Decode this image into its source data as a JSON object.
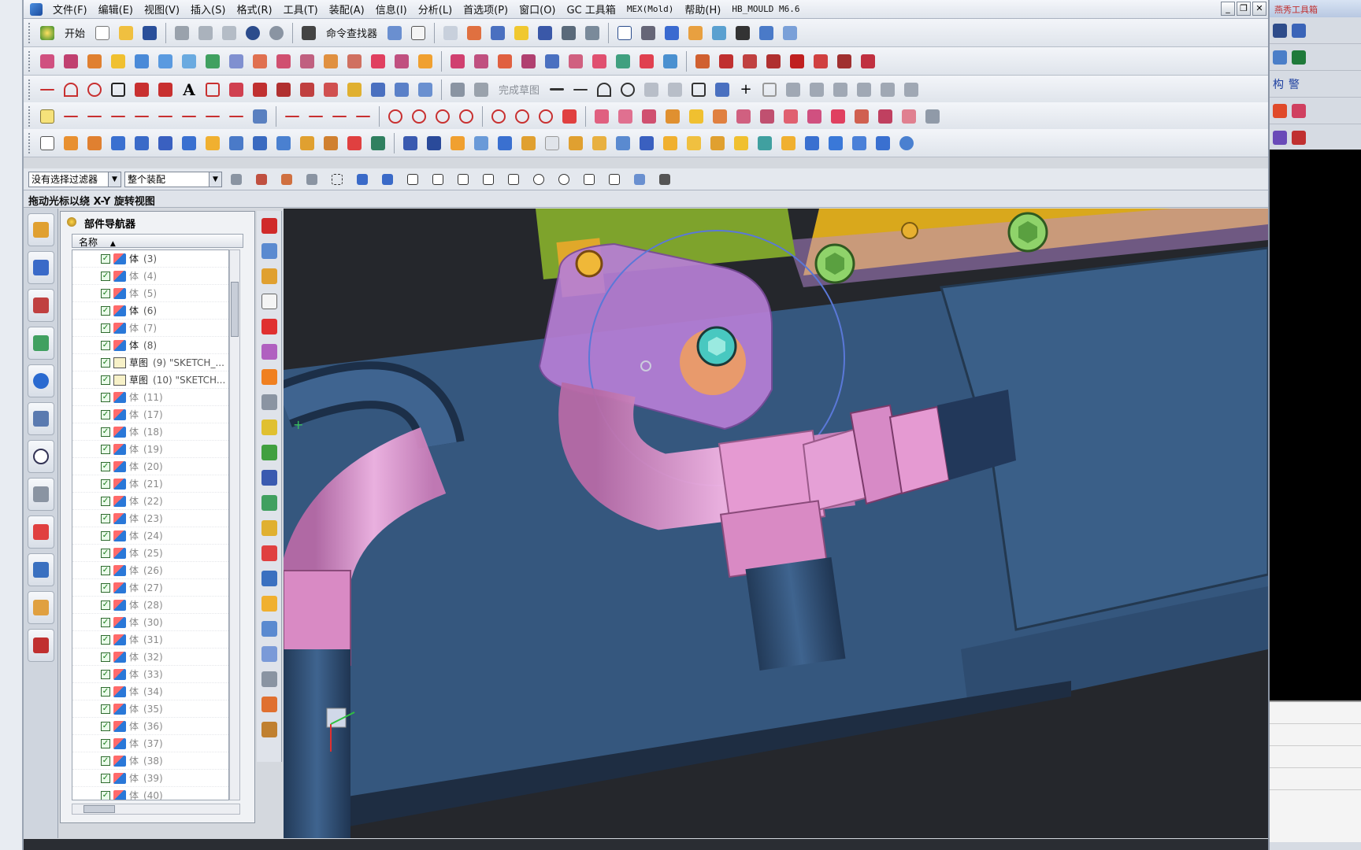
{
  "menu": {
    "items": [
      "文件(F)",
      "编辑(E)",
      "视图(V)",
      "插入(S)",
      "格式(R)",
      "工具(T)",
      "装配(A)",
      "信息(I)",
      "分析(L)",
      "首选项(P)",
      "窗口(O)",
      "GC 工具箱",
      "MEX(Mold)",
      "帮助(H)",
      "HB_MOULD M6.6"
    ]
  },
  "toolbar1": {
    "start_label": "开始",
    "command_finder_label": "命令查找器"
  },
  "sketch_toolbar": {
    "finish_sketch_label": "完成草图"
  },
  "selection_bar": {
    "filter_value": "没有选择过滤器",
    "scope_value": "整个装配"
  },
  "status": {
    "prompt": "拖动光标以绕 X-Y 旋转视图"
  },
  "navigator": {
    "title": "部件导航器",
    "column_name": "名称",
    "rows": [
      {
        "kind": "body",
        "name": "体",
        "num": "(3)",
        "dim": false
      },
      {
        "kind": "body",
        "name": "体",
        "num": "(4)",
        "dim": true
      },
      {
        "kind": "body",
        "name": "体",
        "num": "(5)",
        "dim": true
      },
      {
        "kind": "body",
        "name": "体",
        "num": "(6)",
        "dim": false
      },
      {
        "kind": "body",
        "name": "体",
        "num": "(7)",
        "dim": true
      },
      {
        "kind": "body",
        "name": "体",
        "num": "(8)",
        "dim": false
      },
      {
        "kind": "sketch",
        "name": "草图",
        "num": "(9) \"SKETCH_...",
        "dim": false
      },
      {
        "kind": "sketch",
        "name": "草图",
        "num": "(10) \"SKETCH...",
        "dim": false
      },
      {
        "kind": "body",
        "name": "体",
        "num": "(11)",
        "dim": true
      },
      {
        "kind": "body",
        "name": "体",
        "num": "(17)",
        "dim": true
      },
      {
        "kind": "body",
        "name": "体",
        "num": "(18)",
        "dim": true
      },
      {
        "kind": "body",
        "name": "体",
        "num": "(19)",
        "dim": true
      },
      {
        "kind": "body",
        "name": "体",
        "num": "(20)",
        "dim": true
      },
      {
        "kind": "body",
        "name": "体",
        "num": "(21)",
        "dim": true
      },
      {
        "kind": "body",
        "name": "体",
        "num": "(22)",
        "dim": true
      },
      {
        "kind": "body",
        "name": "体",
        "num": "(23)",
        "dim": true
      },
      {
        "kind": "body",
        "name": "体",
        "num": "(24)",
        "dim": true
      },
      {
        "kind": "body",
        "name": "体",
        "num": "(25)",
        "dim": true
      },
      {
        "kind": "body",
        "name": "体",
        "num": "(26)",
        "dim": true
      },
      {
        "kind": "body",
        "name": "体",
        "num": "(27)",
        "dim": true
      },
      {
        "kind": "body",
        "name": "体",
        "num": "(28)",
        "dim": true
      },
      {
        "kind": "body",
        "name": "体",
        "num": "(30)",
        "dim": true
      },
      {
        "kind": "body",
        "name": "体",
        "num": "(31)",
        "dim": true
      },
      {
        "kind": "body",
        "name": "体",
        "num": "(32)",
        "dim": true
      },
      {
        "kind": "body",
        "name": "体",
        "num": "(33)",
        "dim": true
      },
      {
        "kind": "body",
        "name": "体",
        "num": "(34)",
        "dim": true
      },
      {
        "kind": "body",
        "name": "体",
        "num": "(35)",
        "dim": true
      },
      {
        "kind": "body",
        "name": "体",
        "num": "(36)",
        "dim": true
      },
      {
        "kind": "body",
        "name": "体",
        "num": "(37)",
        "dim": true
      },
      {
        "kind": "body",
        "name": "体",
        "num": "(38)",
        "dim": true
      },
      {
        "kind": "body",
        "name": "体",
        "num": "(39)",
        "dim": true
      },
      {
        "kind": "body",
        "name": "体",
        "num": "(40)",
        "dim": true
      }
    ]
  },
  "right_panel": {
    "title": "燕秀工具箱",
    "label_1": "构",
    "label_2": "警"
  },
  "colors": {
    "mold_blue": "#35577e",
    "pipe_pink": "#e59ad2",
    "clamp_violet": "#b77fd6",
    "plate_yellow": "#d9a81c",
    "block_green": "#7ea32c",
    "bolt_green": "#8fd36a"
  }
}
